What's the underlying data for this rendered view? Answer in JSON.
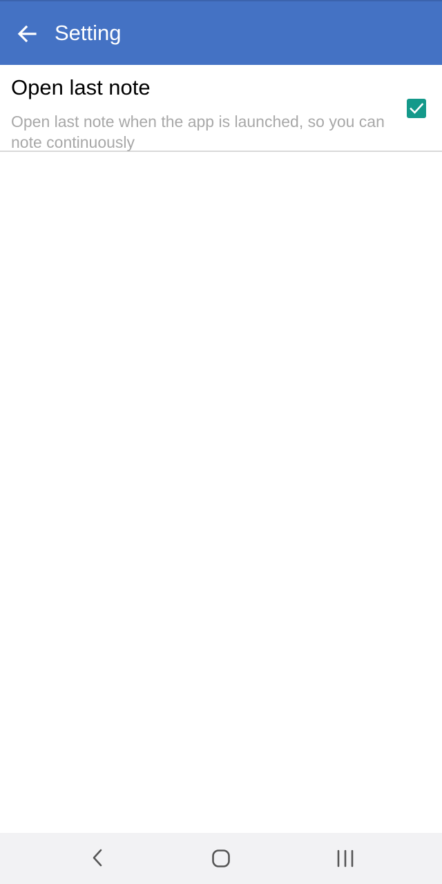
{
  "app_bar": {
    "back_icon": "arrow-back-icon",
    "title": "Setting",
    "background_color": "#4472c4"
  },
  "preferences": [
    {
      "title": "Open last note",
      "summary": "Open last note when the app is launched, so you can note continuously",
      "checked": true,
      "checkbox_color": "#14998a"
    }
  ],
  "system_nav": {
    "back_icon": "chevron-left-icon",
    "home_icon": "home-rounded-square-icon",
    "recents_icon": "recents-bars-icon"
  }
}
